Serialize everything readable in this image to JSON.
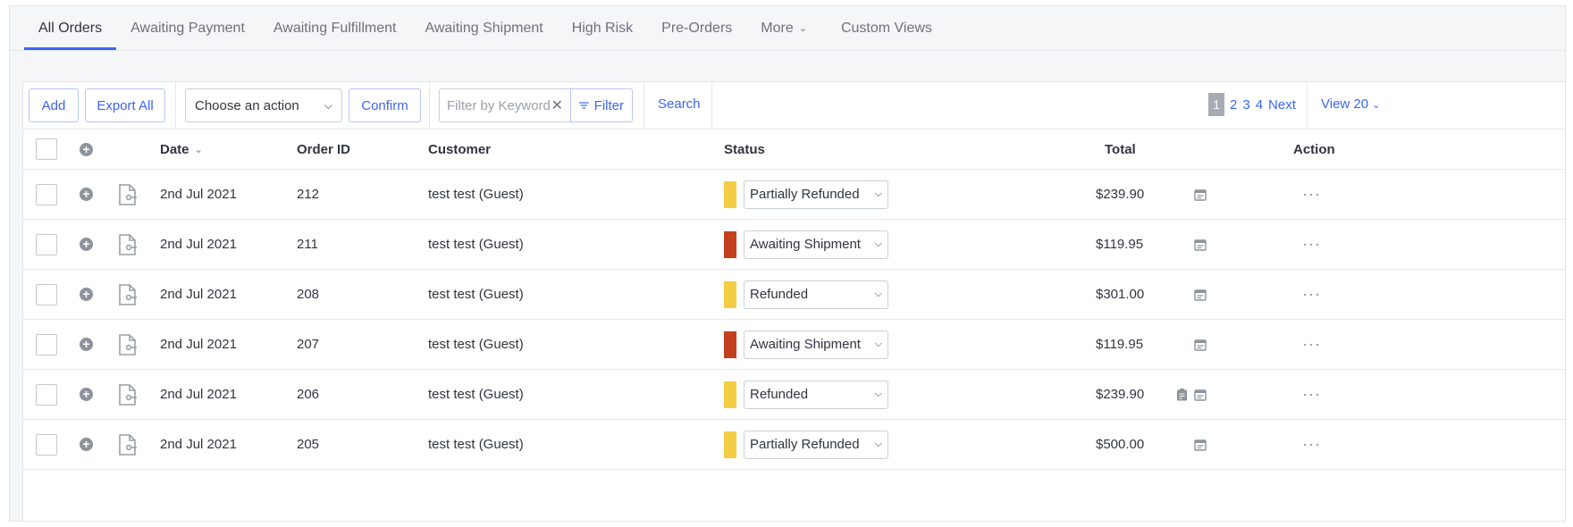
{
  "tabs": [
    {
      "label": "All Orders"
    },
    {
      "label": "Awaiting Payment"
    },
    {
      "label": "Awaiting Fulfillment"
    },
    {
      "label": "Awaiting Shipment"
    },
    {
      "label": "High Risk"
    },
    {
      "label": "Pre-Orders"
    },
    {
      "label": "More"
    },
    {
      "label": "Custom Views"
    }
  ],
  "active_tab": "All Orders",
  "toolbar": {
    "add_label": "Add",
    "export_label": "Export All",
    "action_select": "Choose an action",
    "confirm_label": "Confirm",
    "keyword_placeholder": "Filter by Keyword",
    "filter_label": "Filter",
    "search_label": "Search"
  },
  "pagination": {
    "current": "1",
    "pages": [
      "2",
      "3",
      "4"
    ],
    "next_label": "Next",
    "view_label": "View 20"
  },
  "table": {
    "headers": {
      "date": "Date",
      "order_id": "Order ID",
      "customer": "Customer",
      "status": "Status",
      "total": "Total",
      "action": "Action"
    },
    "rows": [
      {
        "date": "2nd Jul 2021",
        "order_id": "212",
        "customer": "test test (Guest)",
        "status": "Partially Refunded",
        "status_color": "#f4cd45",
        "total": "$239.90"
      },
      {
        "date": "2nd Jul 2021",
        "order_id": "211",
        "customer": "test test (Guest)",
        "status": "Awaiting Shipment",
        "status_color": "#c3401e",
        "total": "$119.95"
      },
      {
        "date": "2nd Jul 2021",
        "order_id": "208",
        "customer": "test test (Guest)",
        "status": "Refunded",
        "status_color": "#f4cd45",
        "total": "$301.00"
      },
      {
        "date": "2nd Jul 2021",
        "order_id": "207",
        "customer": "test test (Guest)",
        "status": "Awaiting Shipment",
        "status_color": "#c3401e",
        "total": "$119.95"
      },
      {
        "date": "2nd Jul 2021",
        "order_id": "206",
        "customer": "test test (Guest)",
        "status": "Refunded",
        "status_color": "#f4cd45",
        "total": "$239.90",
        "has_note": true
      },
      {
        "date": "2nd Jul 2021",
        "order_id": "205",
        "customer": "test test (Guest)",
        "status": "Partially Refunded",
        "status_color": "#f4cd45",
        "total": "$500.00"
      }
    ]
  },
  "colors": {
    "accent": "#3c64f4",
    "status_yellow": "#f4cd45",
    "status_red": "#c3401e"
  }
}
